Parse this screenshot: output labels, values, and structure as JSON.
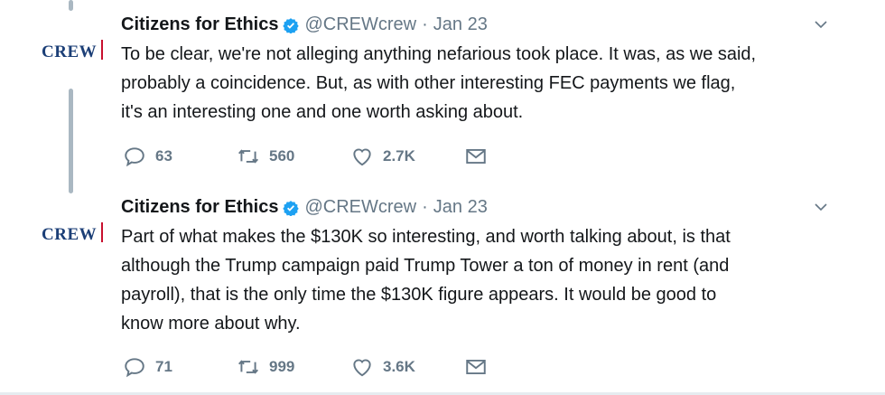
{
  "tweets": [
    {
      "avatar_text": "CREW",
      "name": "Citizens for Ethics",
      "handle": "@CREWcrew",
      "separator": "·",
      "date": "Jan 23",
      "text_lines": [
        "To be clear, we're not alleging anything nefarious took place. It was, as we said,",
        "probably a coincidence. But, as with other interesting FEC payments we flag,",
        "it's an interesting one and one worth asking about."
      ],
      "replies": "63",
      "retweets": "560",
      "likes": "2.7K"
    },
    {
      "avatar_text": "CREW",
      "name": "Citizens for Ethics",
      "handle": "@CREWcrew",
      "separator": "·",
      "date": "Jan 23",
      "text_lines": [
        "Part of what makes the $130K so interesting, and worth talking about, is that",
        "although the Trump campaign paid Trump Tower a ton of money in rent (and",
        "payroll), that is the only time the $130K figure appears. It would be good to",
        "know more about why."
      ],
      "replies": "71",
      "retweets": "999",
      "likes": "3.6K"
    }
  ],
  "colors": {
    "text": "#14171a",
    "muted": "#657786",
    "verified": "#1da1f2",
    "thread_line": "#aab8c2",
    "crew_blue": "#1c3f77",
    "crew_red": "#c8102e"
  },
  "icons": {
    "verified": "verified-badge-icon",
    "menu": "chevron-down-icon",
    "reply": "reply-icon",
    "retweet": "retweet-icon",
    "like": "heart-icon",
    "dm": "envelope-icon"
  }
}
